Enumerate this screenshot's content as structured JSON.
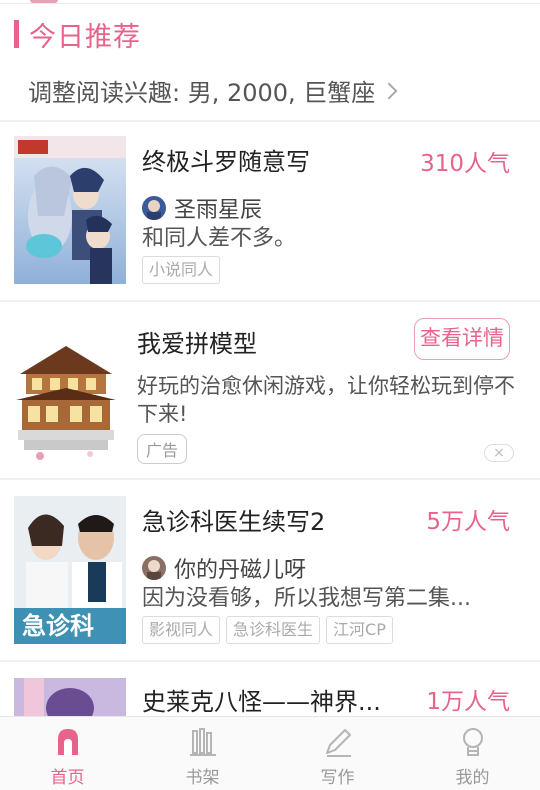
{
  "section": {
    "title": "今日推荐"
  },
  "interest": {
    "label": "调整阅读兴趣: 男, 2000, 巨蟹座"
  },
  "cards": [
    {
      "title": "终极斗罗随意写",
      "popularity": "310人气",
      "author": "圣雨星辰",
      "description": "和同人差不多。",
      "tags": [
        "小说同人"
      ]
    },
    {
      "title": "我爱拼模型",
      "button": "查看详情",
      "description": "好玩的治愈休闲游戏，让你轻松玩到停不下来!",
      "ad_label": "广告",
      "close": "×"
    },
    {
      "title": "急诊科医生续写2",
      "popularity": "5万人气",
      "author": "你的丹磁儿呀",
      "description": "因为没看够，所以我想写第二集...",
      "tags": [
        "影视同人",
        "急诊科医生",
        "江河CP"
      ]
    },
    {
      "title": "史莱克八怪——神界...",
      "popularity": "1万人气"
    }
  ],
  "nav": [
    {
      "label": "首页",
      "icon": "home-icon",
      "active": true
    },
    {
      "label": "书架",
      "icon": "bookshelf-icon",
      "active": false
    },
    {
      "label": "写作",
      "icon": "pen-icon",
      "active": false
    },
    {
      "label": "我的",
      "icon": "profile-icon",
      "active": false
    }
  ],
  "colors": {
    "accent": "#e8638c",
    "muted": "#999999"
  }
}
